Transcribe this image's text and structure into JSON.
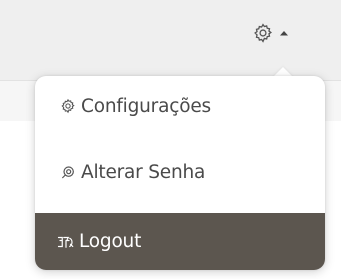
{
  "topbar": {
    "settings_icon": "gear-icon",
    "caret_icon": "caret-up-icon"
  },
  "menu": {
    "items": [
      {
        "label": "Configurações",
        "icon": "gear-icon"
      },
      {
        "label": "Alterar Senha",
        "icon": "link-key-icon"
      },
      {
        "label": "Logout",
        "icon": "logout-icon"
      }
    ]
  },
  "colors": {
    "topbar_bg": "#efefef",
    "menu_bg": "#ffffff",
    "logout_bg": "#5c564f",
    "text": "#4a4a4a",
    "logout_text": "#ffffff"
  }
}
